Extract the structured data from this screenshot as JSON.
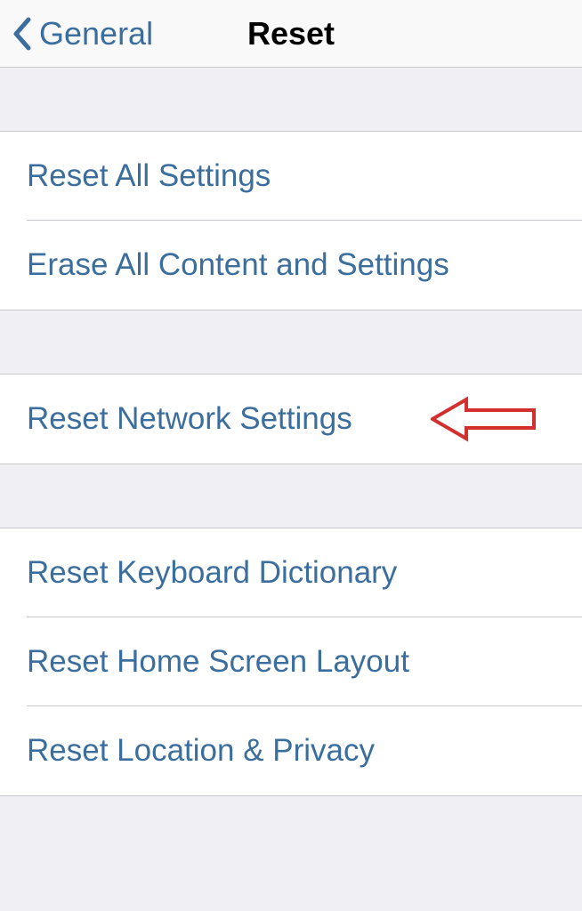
{
  "nav": {
    "back_label": "General",
    "title": "Reset"
  },
  "sections": [
    {
      "items": [
        {
          "label": "Reset All Settings"
        },
        {
          "label": "Erase All Content and Settings"
        }
      ]
    },
    {
      "items": [
        {
          "label": "Reset Network Settings",
          "highlighted": true
        }
      ]
    },
    {
      "items": [
        {
          "label": "Reset Keyboard Dictionary"
        },
        {
          "label": "Reset Home Screen Layout"
        },
        {
          "label": "Reset Location & Privacy"
        }
      ]
    }
  ],
  "annotation": {
    "arrow_color": "#d32f2f"
  }
}
